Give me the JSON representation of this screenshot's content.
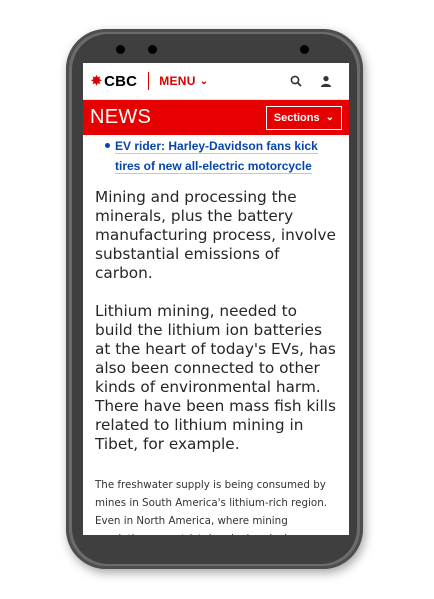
{
  "header": {
    "logo_text": "CBC",
    "menu_label": "MENU",
    "section_title": "NEWS",
    "sections_label": "Sections"
  },
  "icons": {
    "logo": "cbc-gem-icon",
    "menu_chevron": "chevron-down-icon",
    "search": "search-icon",
    "account": "user-icon",
    "sections_chevron": "chevron-down-icon"
  },
  "colors": {
    "brand_red": "#e60000",
    "link_blue": "#0645ad"
  },
  "article": {
    "related_links": [
      "EV rider: Harley-Davidson fans kick tires of new all-electric motorcycle"
    ],
    "paragraphs": [
      "Mining and processing the minerals, plus the battery manufacturing process, involve substantial emissions of carbon.",
      "Lithium mining, needed to build the lithium ion batteries at the heart of today's EVs, has also been connected to other kinds of environmental harm. There have been mass fish kills related to lithium mining in Tibet, for example.",
      "The freshwater supply is being consumed by mines in South America's lithium-rich region. Even in North America, where mining regulations are strict, harsh chemicals are used in processing, and without"
    ]
  }
}
